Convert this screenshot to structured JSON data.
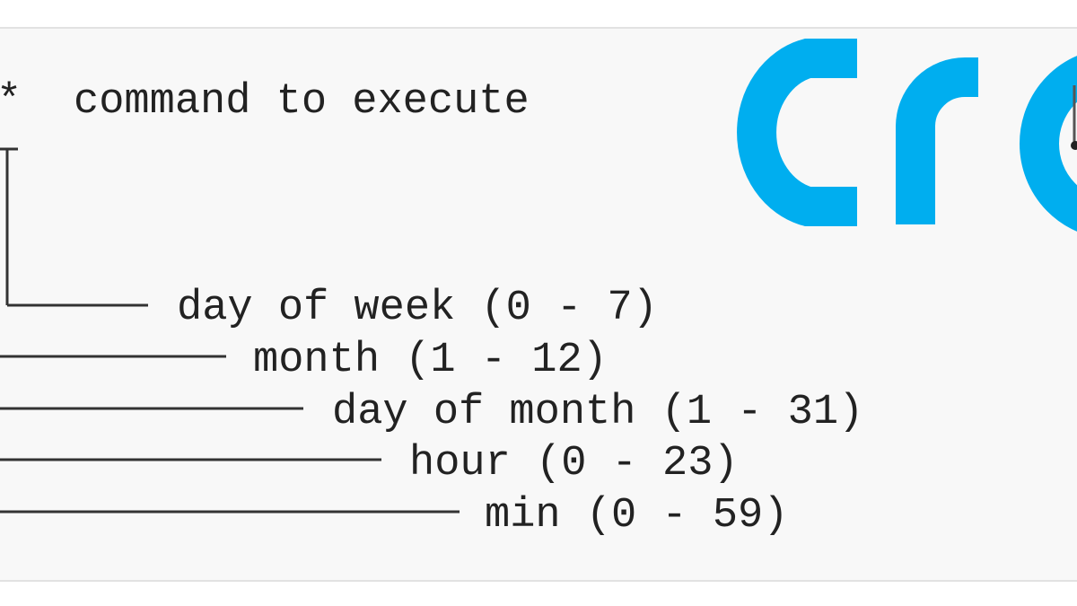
{
  "diagram": {
    "header_asterisk": "*",
    "command_label": "command to execute",
    "fields": [
      {
        "label": "day of week (0 - 7)"
      },
      {
        "label": "month (1 - 12)"
      },
      {
        "label": "day of month (1 - 31)"
      },
      {
        "label": "hour (0 - 23)"
      },
      {
        "label": "min (0 - 59)"
      }
    ]
  },
  "logo": {
    "text": "cro",
    "color": "#00aeef"
  },
  "colors": {
    "background": "#f8f8f8",
    "text": "#222222",
    "lines": "#333333"
  }
}
